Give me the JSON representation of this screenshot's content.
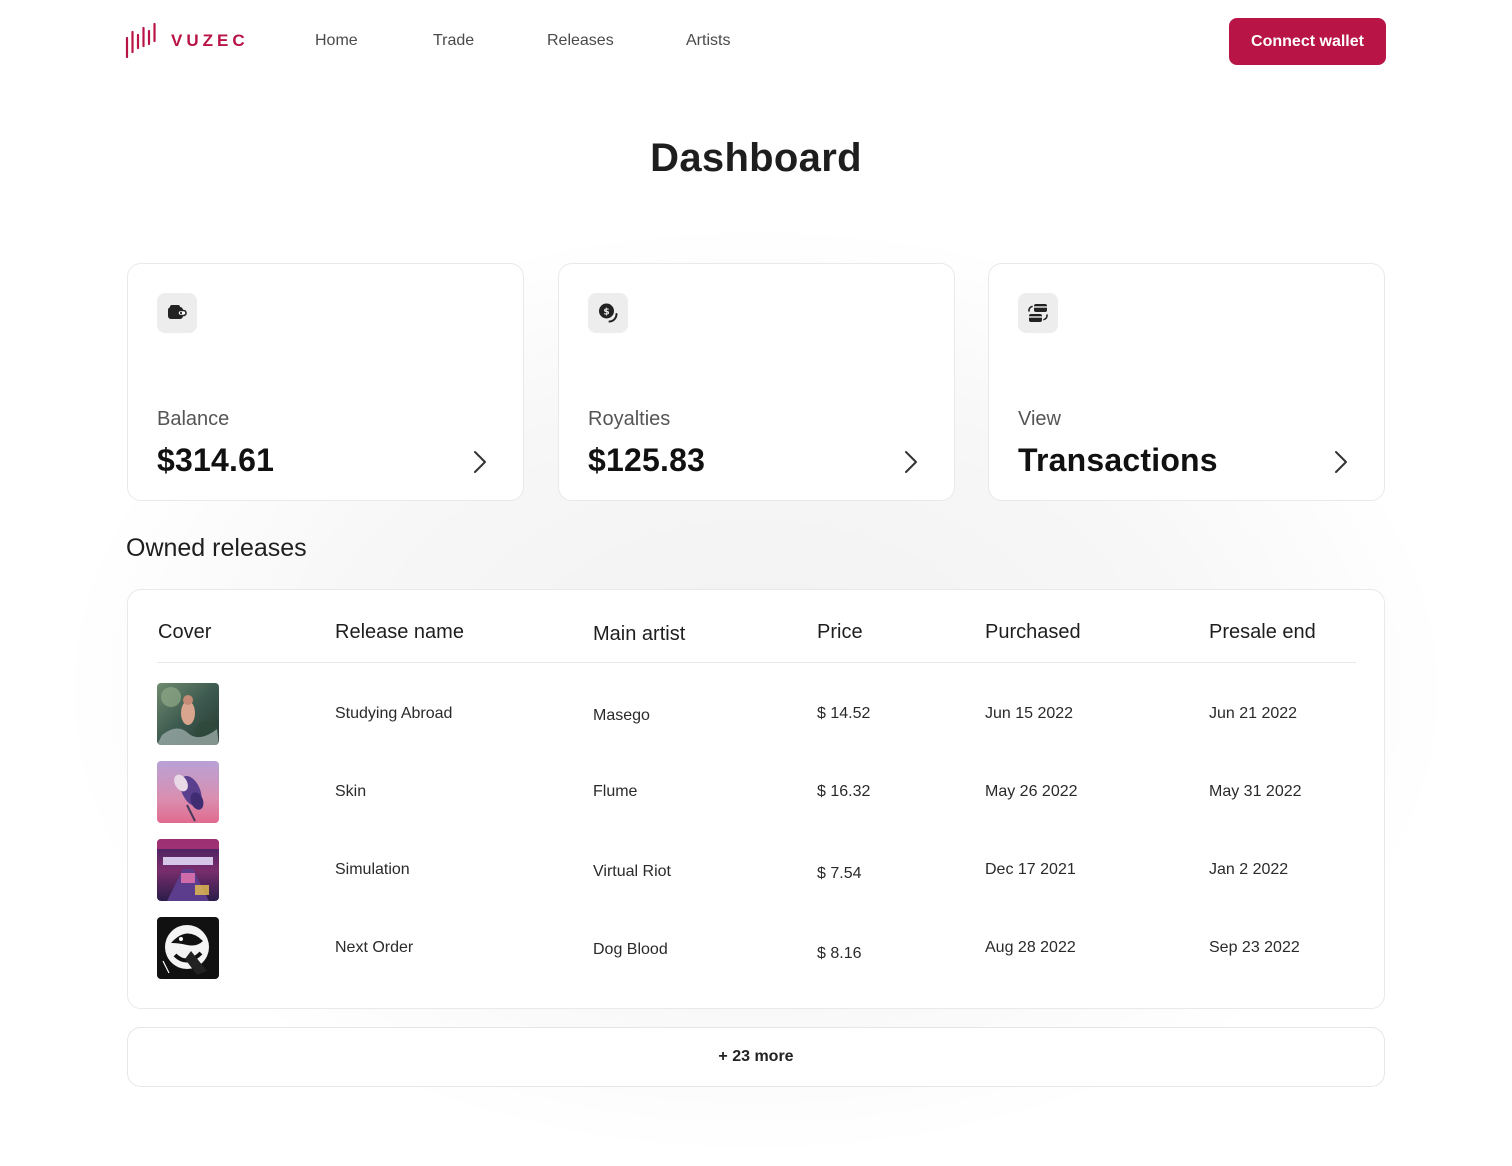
{
  "brand": {
    "name": "VUZEC",
    "color": "#b81445"
  },
  "nav": [
    {
      "label": "Home"
    },
    {
      "label": "Trade"
    },
    {
      "label": "Releases"
    },
    {
      "label": "Artists"
    }
  ],
  "header": {
    "connect_label": "Connect wallet"
  },
  "page": {
    "title": "Dashboard"
  },
  "cards": [
    {
      "icon": "wallet-icon",
      "label": "Balance",
      "value": "$314.61"
    },
    {
      "icon": "royalty-coin-icon",
      "label": "Royalties",
      "value": "$125.83"
    },
    {
      "icon": "transactions-icon",
      "label": "View",
      "value": "Transactions"
    }
  ],
  "releases": {
    "title": "Owned releases",
    "columns": [
      "Cover",
      "Release name",
      "Main artist",
      "Price",
      "Purchased",
      "Presale end"
    ],
    "rows": [
      {
        "name": "Studying Abroad",
        "artist": "Masego",
        "price": "$ 14.52",
        "purchased": "Jun 15 2022",
        "presale_end": "Jun 21 2022"
      },
      {
        "name": "Skin",
        "artist": "Flume",
        "price": "$ 16.32",
        "purchased": "May 26 2022",
        "presale_end": "May 31 2022"
      },
      {
        "name": "Simulation",
        "artist": "Virtual Riot",
        "price": "$ 7.54",
        "purchased": "Dec 17 2021",
        "presale_end": "Jan 2 2022"
      },
      {
        "name": "Next Order",
        "artist": "Dog Blood",
        "price": "$ 8.16",
        "purchased": "Aug 28 2022",
        "presale_end": "Sep 23 2022"
      }
    ],
    "more_label": "+ 23 more"
  }
}
